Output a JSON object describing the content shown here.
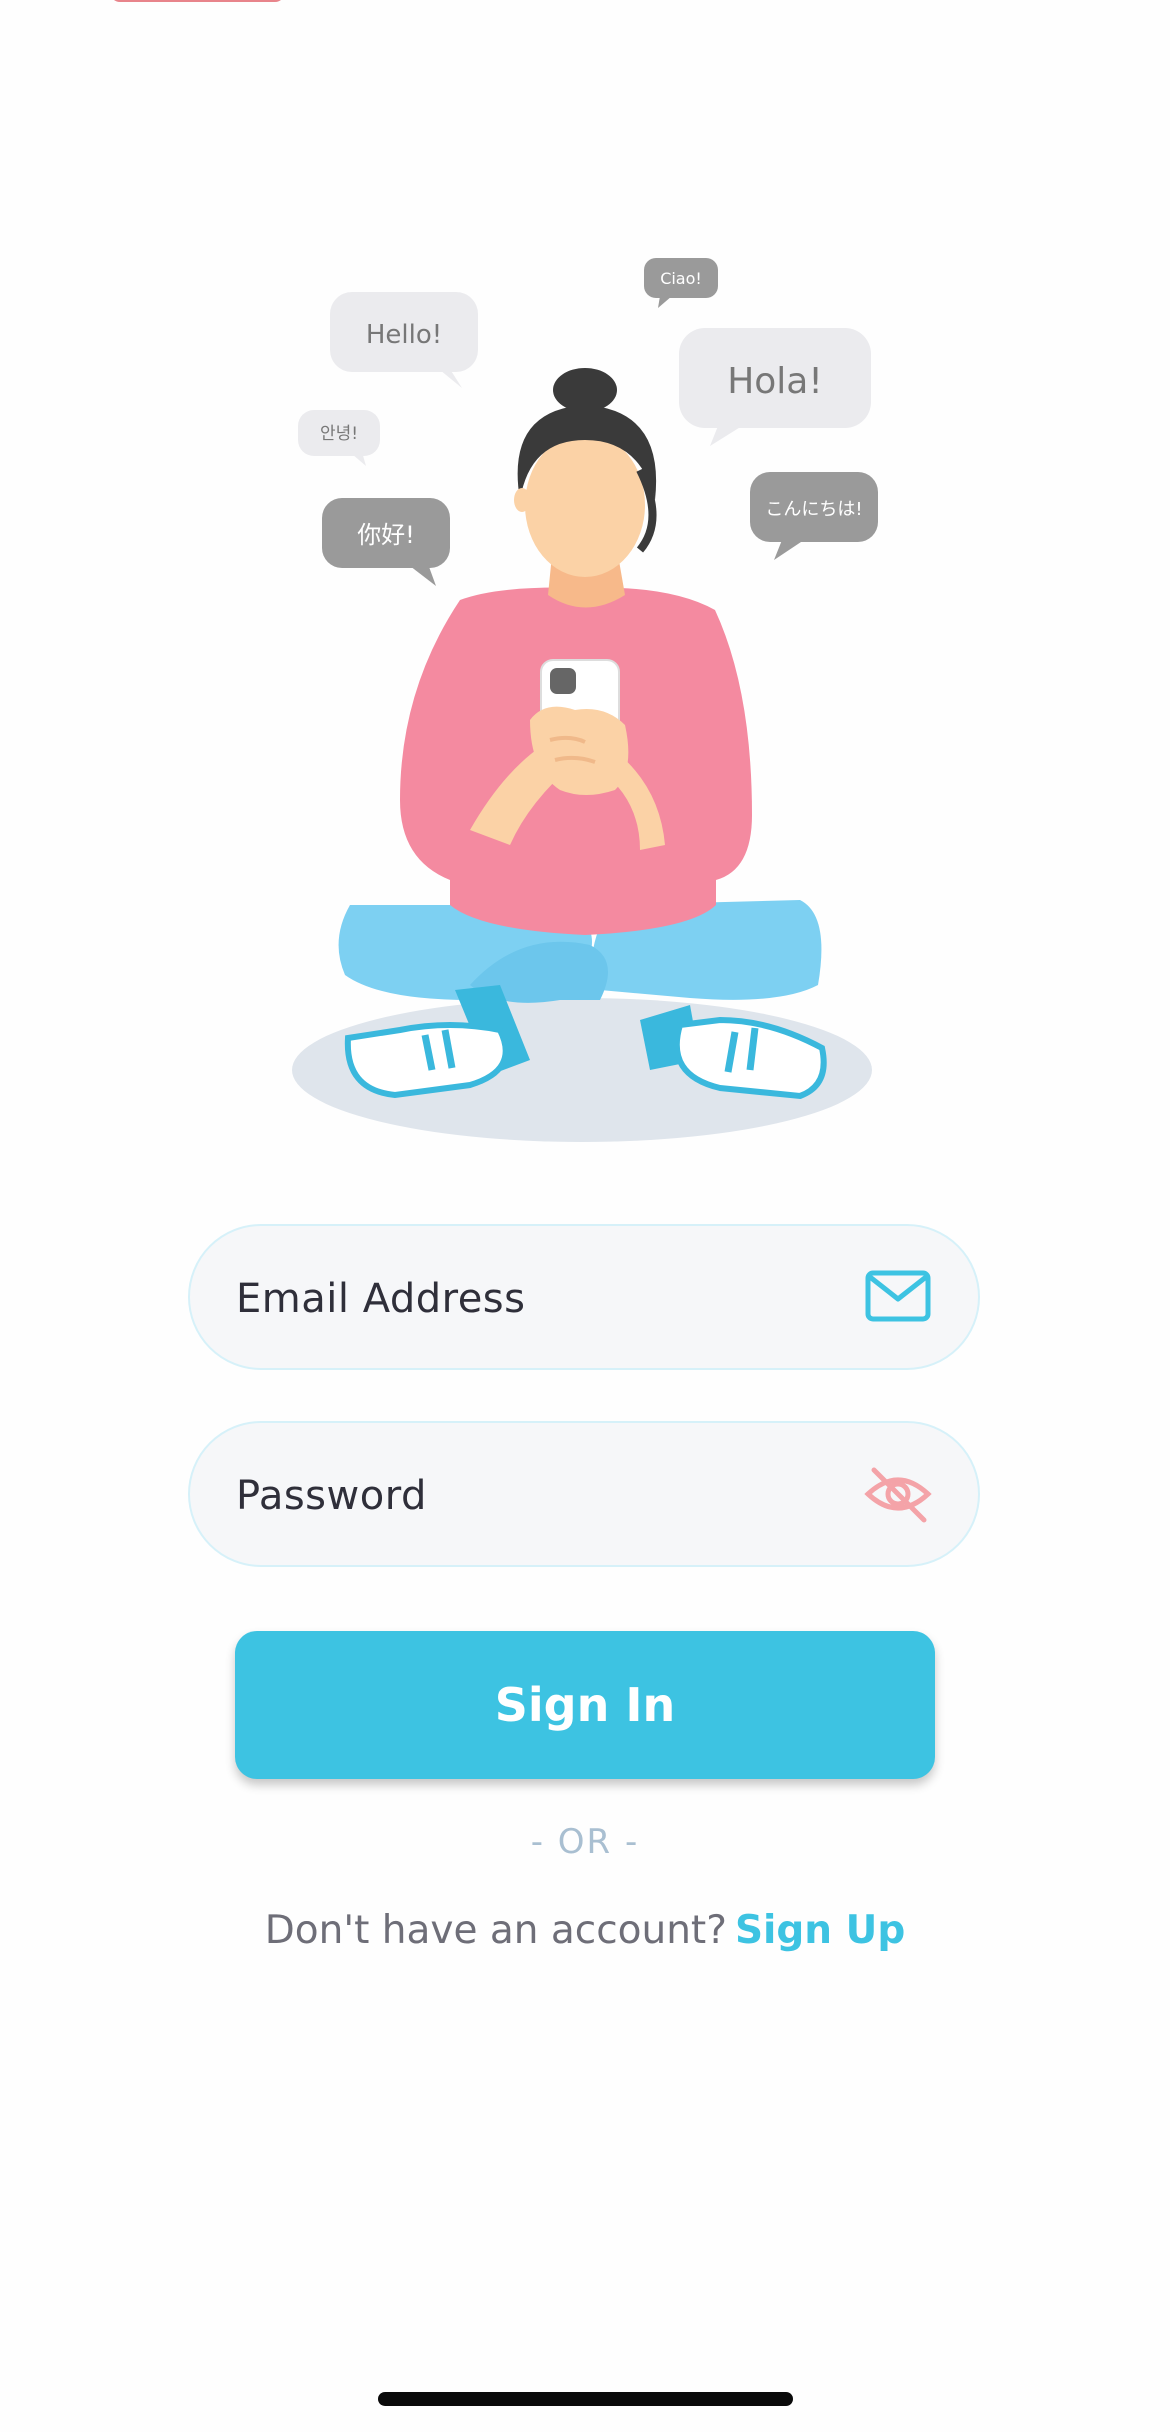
{
  "illustration": {
    "bubbles": {
      "hello": "Hello!",
      "ciao": "Ciao!",
      "hola": "Hola!",
      "annyeong": "안녕!",
      "nihao": "你好!",
      "konnichiwa": "こんにちは!"
    }
  },
  "form": {
    "email": {
      "placeholder": "Email Address",
      "icon": "mail-icon"
    },
    "password": {
      "placeholder": "Password",
      "icon": "eye-off-icon"
    },
    "signin_label": "Sign In"
  },
  "divider": "- OR -",
  "footer": {
    "prompt": "Don't have an account?",
    "signup_label": "Sign Up"
  },
  "colors": {
    "accent": "#3dc3e2",
    "eye_icon": "#f4a3a8",
    "divider": "#a9bfd1"
  }
}
